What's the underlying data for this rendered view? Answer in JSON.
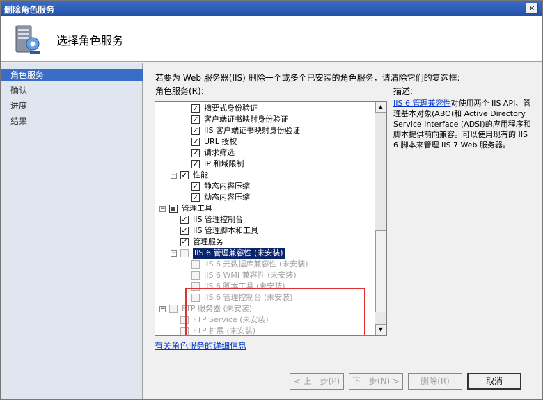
{
  "window": {
    "title": "删除角色服务",
    "close_label": "×"
  },
  "header": {
    "title": "选择角色服务",
    "icon": "server-roles-icon"
  },
  "sidebar": {
    "items": [
      {
        "label": "角色服务",
        "active": true
      },
      {
        "label": "确认",
        "active": false
      },
      {
        "label": "进度",
        "active": false
      },
      {
        "label": "结果",
        "active": false
      }
    ]
  },
  "main": {
    "instruction": "若要为 Web 服务器(IIS) 删除一个或多个已安装的角色服务，请清除它们的复选框:",
    "list_label": "角色服务(R):",
    "more_info_link": "有关角色服务的详细信息",
    "description_label": "描述:",
    "description_link": "IIS 6 管理兼容性",
    "description_text": "对使用两个 IIS API、管理基本对象(ABO)和 Active Directory Service Interface (ADSI)的应用程序和脚本提供前向兼容。可以使用现有的 IIS 6 脚本来管理 IIS 7 Web 服务器。"
  },
  "tree": {
    "rows": [
      {
        "label": "摘要式身份验证",
        "level": 3,
        "state": "checked",
        "enabled": true
      },
      {
        "label": "客户端证书映射身份验证",
        "level": 3,
        "state": "checked",
        "enabled": true
      },
      {
        "label": "IIS 客户端证书映射身份验证",
        "level": 3,
        "state": "checked",
        "enabled": true
      },
      {
        "label": "URL 授权",
        "level": 3,
        "state": "checked",
        "enabled": true
      },
      {
        "label": "请求筛选",
        "level": 3,
        "state": "checked",
        "enabled": true
      },
      {
        "label": "IP 和域限制",
        "level": 3,
        "state": "checked",
        "enabled": true
      },
      {
        "label": "性能",
        "level": 2,
        "state": "checked",
        "enabled": true,
        "expander": "−"
      },
      {
        "label": "静态内容压缩",
        "level": 3,
        "state": "checked",
        "enabled": true
      },
      {
        "label": "动态内容压缩",
        "level": 3,
        "state": "checked",
        "enabled": true
      },
      {
        "label": "管理工具",
        "level": 1,
        "state": "partial",
        "enabled": true,
        "expander": "−"
      },
      {
        "label": "IIS 管理控制台",
        "level": 2,
        "state": "checked",
        "enabled": true
      },
      {
        "label": "IIS 管理脚本和工具",
        "level": 2,
        "state": "checked",
        "enabled": true
      },
      {
        "label": "管理服务",
        "level": 2,
        "state": "checked",
        "enabled": true
      },
      {
        "label": "IIS 6 管理兼容性  (未安装)",
        "level": 2,
        "state": "unchecked",
        "enabled": false,
        "expander": "−",
        "selected": true
      },
      {
        "label": "IIS 6 元数据库兼容性  (未安装)",
        "level": 3,
        "state": "unchecked",
        "enabled": false
      },
      {
        "label": "IIS 6 WMI 兼容性  (未安装)",
        "level": 3,
        "state": "unchecked",
        "enabled": false
      },
      {
        "label": "IIS 6 脚本工具  (未安装)",
        "level": 3,
        "state": "unchecked",
        "enabled": false
      },
      {
        "label": "IIS 6 管理控制台  (未安装)",
        "level": 3,
        "state": "unchecked",
        "enabled": false
      },
      {
        "label": "FTP 服务器  (未安装)",
        "level": 1,
        "state": "unchecked",
        "enabled": false,
        "expander": "−"
      },
      {
        "label": "FTP Service  (未安装)",
        "level": 2,
        "state": "unchecked",
        "enabled": false
      },
      {
        "label": "FTP 扩展  (未安装)",
        "level": 2,
        "state": "unchecked",
        "enabled": false
      }
    ]
  },
  "buttons": {
    "prev": "< 上一步(P)",
    "next": "下一步(N) >",
    "remove": "删除(R)",
    "cancel": "取消"
  },
  "scroll_position": 0.6
}
